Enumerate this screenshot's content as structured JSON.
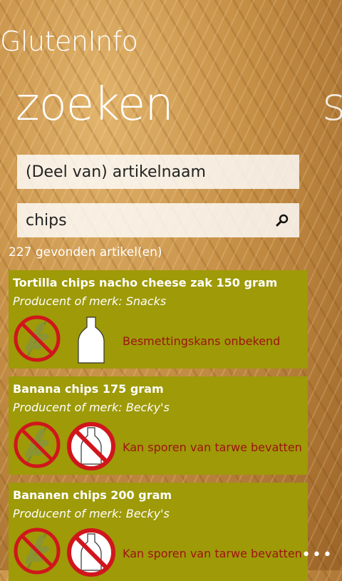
{
  "app": {
    "title": "GlutenInfo"
  },
  "pivot": {
    "current": "zoeken",
    "next_peek": "s"
  },
  "search": {
    "name_placeholder": "(Deel van) artikelnaam",
    "query": "chips",
    "results_count": "227 gevonden artikel(en)"
  },
  "results": [
    {
      "title": "Tortilla chips nacho cheese zak 150 gram",
      "brand": "Producent of merk: Snacks",
      "status": "Besmettingskans onbekend",
      "bottle_icon": "bottle-icon"
    },
    {
      "title": "Banana chips 175 gram",
      "brand": "Producent of merk: Becky's",
      "status": "Kan sporen van tarwe bevatten",
      "bottle_icon": "no-bottle-icon"
    },
    {
      "title": "Bananen chips 200 gram",
      "brand": "Producent of merk: Becky's",
      "status": "Kan sporen van tarwe bevatten",
      "bottle_icon": "no-bottle-icon"
    }
  ],
  "appbar": {
    "more": "•••"
  },
  "colors": {
    "card": "#9e9a08",
    "status_text": "#9e1212",
    "prohibit": "#d0161c"
  }
}
